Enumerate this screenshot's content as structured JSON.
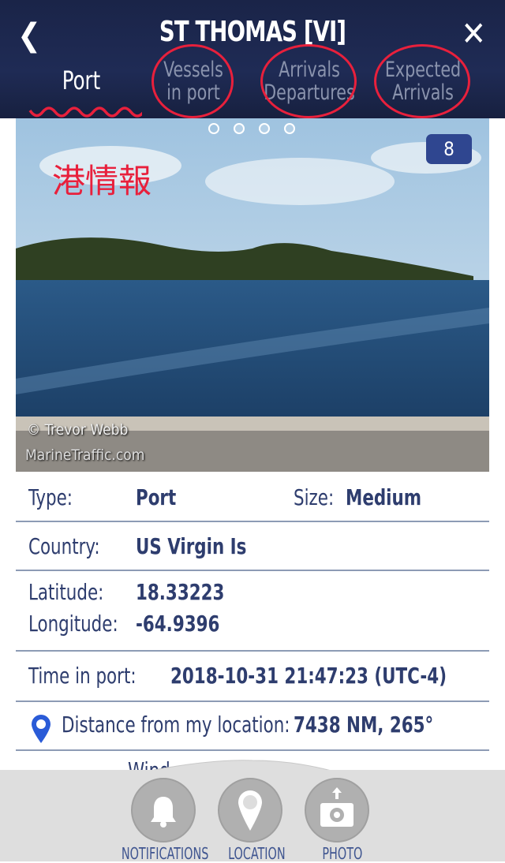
{
  "header": {
    "title": "ST THOMAS [VI]",
    "back_icon": "chevron-left-icon",
    "close_icon": "close-icon"
  },
  "tabs": [
    {
      "label": "Port",
      "active": true
    },
    {
      "label": "Vessels in port"
    },
    {
      "label": "Arrivals Departures"
    },
    {
      "label": "Expected Arrivals"
    }
  ],
  "tab_lines": {
    "vessels": [
      "Vessels",
      "in port"
    ],
    "arrivals": [
      "Arrivals",
      "Departures"
    ],
    "expected": [
      "Expected",
      "Arrivals"
    ]
  },
  "photo": {
    "count": "8",
    "pages": 4,
    "current_page": 1,
    "credit": "© Trevor Webb",
    "watermark": "MarineTraffic.com"
  },
  "annotation": {
    "text": "港情報",
    "color": "#e8203c"
  },
  "details": {
    "type_label": "Type:",
    "type_value": "Port",
    "size_label": "Size:",
    "size_value": "Medium",
    "country_label": "Country:",
    "country_value": "US Virgin Is",
    "lat_label": "Latitude:",
    "lat_value": "18.33223",
    "lon_label": "Longitude:",
    "lon_value": "-64.9396",
    "time_label": "Time in port:",
    "time_value": "2018-10-31 21:47:23 (UTC-4)",
    "distance_label": "Distance from my location:",
    "distance_value": "7438 NM, 265°",
    "wind_label": "Wind"
  },
  "footer": {
    "notifications": "NOTIFICATIONS",
    "location": "LOCATION",
    "photo": "PHOTO"
  },
  "colors": {
    "header": "#1f2b55",
    "text": "#2e3d6e",
    "badge": "#2f4690",
    "pin": "#2a5bd7"
  }
}
